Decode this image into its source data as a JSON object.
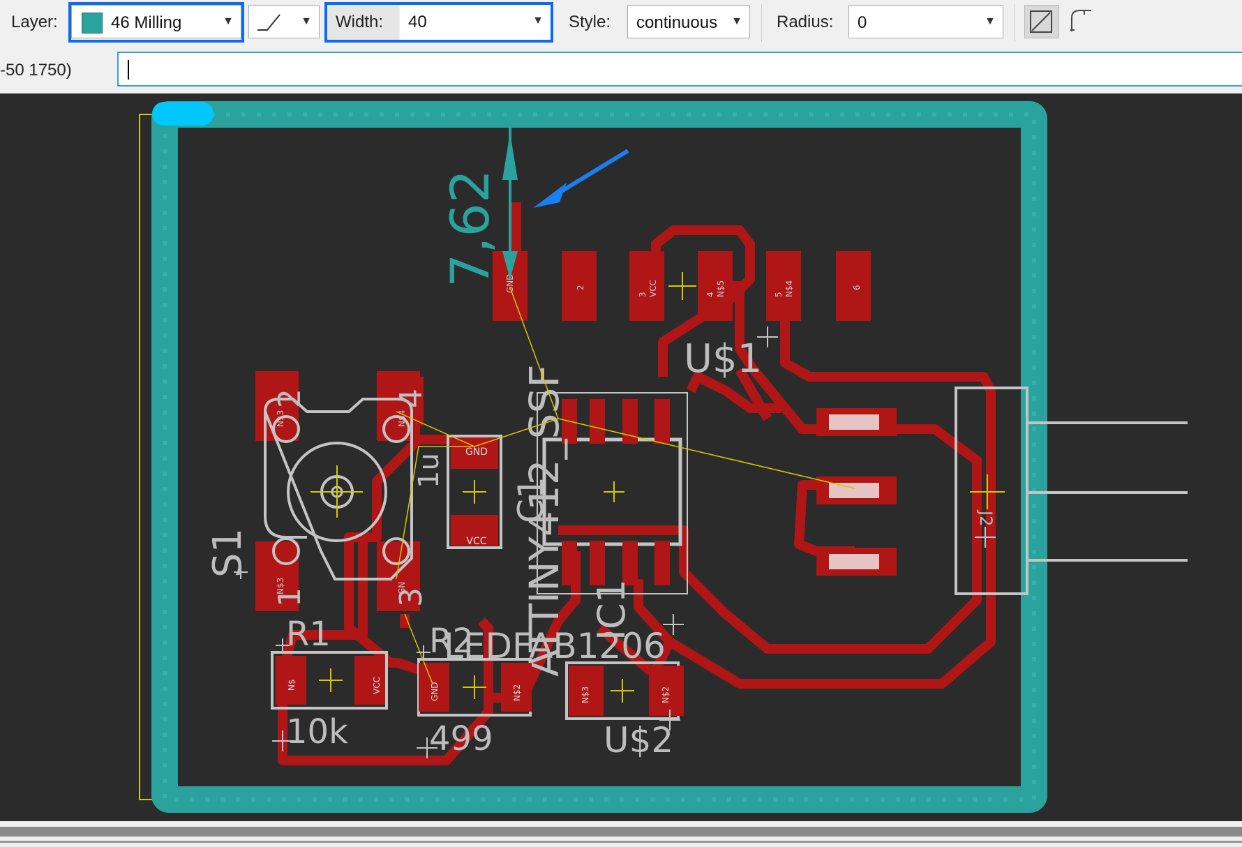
{
  "toolbar": {
    "layer_label": "Layer:",
    "layer_value": "46 Milling",
    "layer_color": "#2aa39e",
    "width_label": "Width:",
    "width_value": "40",
    "style_label": "Style:",
    "style_value": "continuous",
    "radius_label": "Radius:",
    "radius_value": "0",
    "wire_bend_icon": "wire-bend-icon",
    "miter_icons": [
      "miter-straight-icon",
      "miter-round-icon"
    ]
  },
  "command_row": {
    "coordinates": "-50 1750)",
    "command_value": ""
  },
  "board": {
    "colors": {
      "milling": "#2aa39e",
      "copper": "#b01616",
      "silk": "#c4c4c4",
      "airwire": "#d4c800",
      "origin": "#00c8ff",
      "annotation_arrow": "#1a7ff0"
    },
    "dimension_label": "7,62",
    "components": {
      "u1_name": "U$1",
      "u1_pads": [
        "GND",
        "2",
        "VCC",
        "N$5",
        "N$4",
        "6"
      ],
      "u1_pad_numbers": [
        "",
        "",
        "3",
        "4",
        "5",
        ""
      ],
      "ic1_name": "IC1",
      "ic1_value": "ATTINY412_SSF",
      "s1_name": "S1",
      "s1_pins": [
        "1",
        "2",
        "3",
        "4"
      ],
      "s1_pin_labels": [
        "1",
        "2",
        "3",
        "4"
      ],
      "c1_name": "C1",
      "c1_value": "1u",
      "c1_pads": [
        "GND",
        "VCC"
      ],
      "r1_name": "R1",
      "r1_value": "10k",
      "r1_pads": [
        "N$",
        "VCC"
      ],
      "r2_name": "R2",
      "r2_value": "499",
      "r2_pads": [
        "GND",
        "N$2"
      ],
      "led_name": "LEDFAB1206",
      "u2_name": "U$2",
      "u2_pads": [
        "N$3",
        "N$2"
      ],
      "j2_name": "J2",
      "s1_pad_nets": [
        "N$3",
        "N$3",
        "GN",
        "N$4"
      ]
    }
  }
}
